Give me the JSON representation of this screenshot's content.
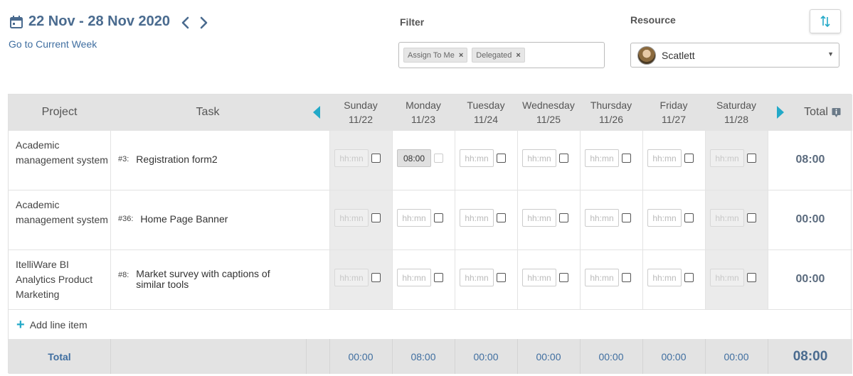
{
  "header": {
    "week_range": "22 Nov - 28 Nov 2020",
    "go_current_week": "Go to Current Week",
    "filter_label": "Filter",
    "filter_chips": [
      {
        "label": "Assign To Me"
      },
      {
        "label": "Delegated"
      }
    ],
    "chip_remove_glyph": "×",
    "resource_label": "Resource",
    "resource_value": "Scatlett",
    "dropdown_caret": "▼"
  },
  "table": {
    "columns": {
      "project": "Project",
      "task": "Task",
      "total": "Total"
    },
    "days": [
      {
        "name": "Sunday",
        "date": "11/22"
      },
      {
        "name": "Monday",
        "date": "11/23"
      },
      {
        "name": "Tuesday",
        "date": "11/24"
      },
      {
        "name": "Wednesday",
        "date": "11/25"
      },
      {
        "name": "Thursday",
        "date": "11/26"
      },
      {
        "name": "Friday",
        "date": "11/27"
      },
      {
        "name": "Saturday",
        "date": "11/28"
      }
    ],
    "time_placeholder": "hh:mn",
    "rows": [
      {
        "project": "Academic management system",
        "task_num": "#3:",
        "task_name": "Registration form2",
        "entries": [
          "",
          "08:00",
          "",
          "",
          "",
          "",
          ""
        ],
        "total": "08:00"
      },
      {
        "project": "Academic management system",
        "task_num": "#36:",
        "task_name": "Home Page Banner",
        "entries": [
          "",
          "",
          "",
          "",
          "",
          "",
          ""
        ],
        "total": "00:00"
      },
      {
        "project": "ItelliWare BI Analytics Product Marketing",
        "task_num": "#8:",
        "task_name": "Market survey with captions of similar tools",
        "entries": [
          "",
          "",
          "",
          "",
          "",
          "",
          ""
        ],
        "total": "00:00"
      }
    ],
    "add_line_item": "Add line item",
    "add_icon": "+",
    "footer": {
      "label": "Total",
      "day_totals": [
        "00:00",
        "08:00",
        "00:00",
        "00:00",
        "00:00",
        "00:00",
        "00:00"
      ],
      "grand_total": "08:00"
    }
  },
  "colors": {
    "accent": "#23a9c8",
    "title": "#4a6b8f",
    "link": "#3f6ea0",
    "header_bg": "#e3e3e3"
  },
  "icons": [
    "calendar-icon",
    "chevron-left-icon",
    "chevron-right-icon",
    "sort-icon",
    "info-icon",
    "scroll-left-icon",
    "scroll-right-icon",
    "plus-icon"
  ]
}
